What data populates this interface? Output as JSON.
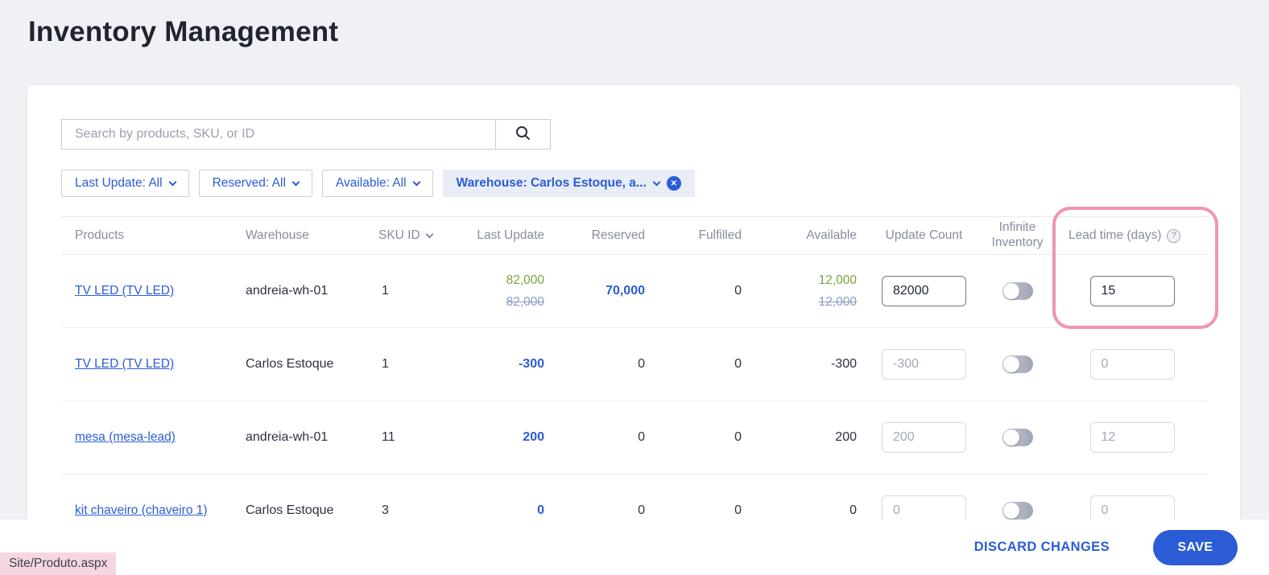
{
  "page": {
    "title": "Inventory Management"
  },
  "search": {
    "placeholder": "Search by products, SKU, or ID"
  },
  "filters": {
    "last_update": "Last Update: All",
    "reserved": "Reserved: All",
    "available": "Available: All",
    "warehouse": "Warehouse: Carlos Estoque, a..."
  },
  "table": {
    "headers": {
      "products": "Products",
      "warehouse": "Warehouse",
      "sku": "SKU ID",
      "last_update": "Last Update",
      "reserved": "Reserved",
      "fulfilled": "Fulfilled",
      "available": "Available",
      "update_count": "Update Count",
      "infinite_inventory": "Infinite\nInventory",
      "lead_time": "Lead time (days)"
    },
    "rows": [
      {
        "product": "TV LED (TV LED)",
        "warehouse": "andreia-wh-01",
        "sku": "1",
        "last_update_new": "82,000",
        "last_update_old": "82,000",
        "reserved": "70,000",
        "fulfilled": "0",
        "available_new": "12,000",
        "available_old": "12,000",
        "update_count": "82000",
        "lead_time": "15"
      },
      {
        "product": "TV LED (TV LED)",
        "warehouse": "Carlos Estoque",
        "sku": "1",
        "last_update": "-300",
        "reserved": "0",
        "fulfilled": "0",
        "available": "-300",
        "update_count": "-300",
        "lead_time": "0"
      },
      {
        "product": "mesa (mesa-lead)",
        "warehouse": "andreia-wh-01",
        "sku": "11",
        "last_update": "200",
        "reserved": "0",
        "fulfilled": "0",
        "available": "200",
        "update_count": "200",
        "lead_time": "12"
      },
      {
        "product": "kit chaveiro (chaveiro 1)",
        "warehouse": "Carlos Estoque",
        "sku": "3",
        "last_update": "0",
        "reserved": "0",
        "fulfilled": "0",
        "available": "0",
        "update_count": "0",
        "lead_time": "0"
      }
    ]
  },
  "footer": {
    "discard": "DISCARD CHANGES",
    "save": "SAVE"
  },
  "status_bar": {
    "text": "Site/Produto.aspx"
  },
  "colors": {
    "accent": "#2b5cd6",
    "green": "#7aa33e",
    "highlight_pink": "#f193b4"
  }
}
